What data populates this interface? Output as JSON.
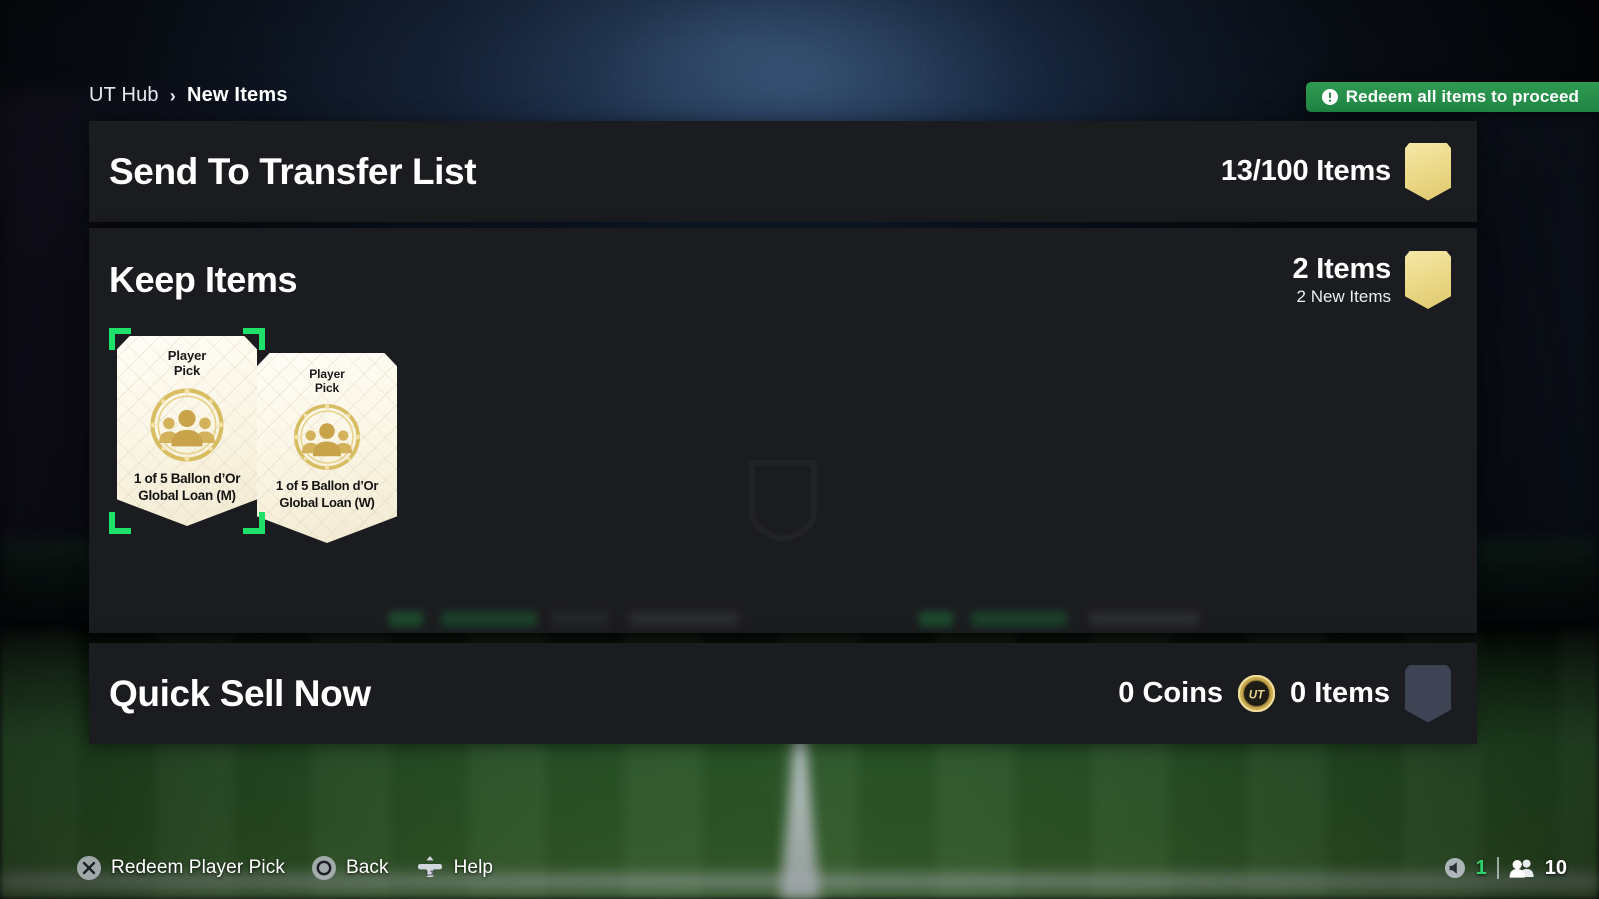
{
  "breadcrumb": {
    "root": "UT Hub",
    "separator": "›",
    "current": "New Items"
  },
  "banner": {
    "text": "Redeem all items to proceed",
    "icon": "warning-circle-icon",
    "color": "#2f9a52"
  },
  "panels": {
    "transfer": {
      "title": "Send To Transfer List",
      "count": "13/100 Items",
      "badge_color": "#ecd988"
    },
    "keep": {
      "title": "Keep Items",
      "count": "2 Items",
      "count_sub": "2 New Items",
      "badge_color": "#ecd988"
    },
    "quick_sell": {
      "title": "Quick Sell Now",
      "coins": "0  Coins",
      "coin_icon": "ut-coin-icon",
      "items": "0 Items",
      "badge_color": "#3e4453"
    }
  },
  "cards": [
    {
      "kicker": "Player\nPick",
      "kicker_line1": "Player",
      "kicker_line2": "Pick",
      "label_line1": "1 of 5 Ballon d’Or",
      "label_line2": "Global Loan (M)",
      "emblem": "player-pick-emblem",
      "selected": true
    },
    {
      "kicker_line1": "Player",
      "kicker_line2": "Pick",
      "label_line1": "1 of 5 Ballon d’Or",
      "label_line2": "Global Loan (W)",
      "emblem": "player-pick-emblem",
      "selected": false
    }
  ],
  "bottom_bar": {
    "hints": [
      {
        "button": "cross-button-icon",
        "label": "Redeem Player Pick"
      },
      {
        "button": "circle-button-icon",
        "label": "Back"
      },
      {
        "button": "l3-stick-icon",
        "label": "Help"
      }
    ],
    "status": {
      "volume_icon": "speaker-icon",
      "volume_value": "1",
      "players_icon": "people-icon",
      "players_value": "10",
      "volume_color": "#2fd36a"
    }
  }
}
